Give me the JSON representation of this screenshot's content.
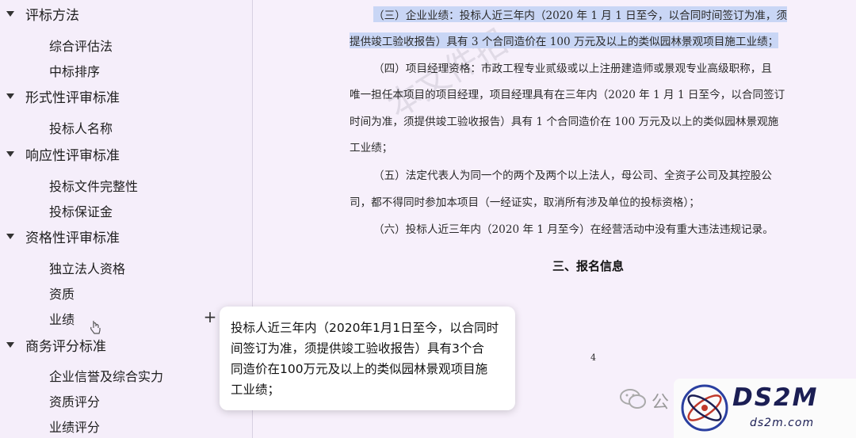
{
  "sidebar": {
    "groups": [
      {
        "label": "评标方法",
        "items": [
          "综合评估法",
          "中标排序"
        ]
      },
      {
        "label": "形式性评审标准",
        "items": [
          "投标人名称"
        ]
      },
      {
        "label": "响应性评审标准",
        "items": [
          "投标文件完整性",
          "投标保证金"
        ]
      },
      {
        "label": "资格性评审标准",
        "items": [
          "独立法人资格",
          "资质",
          "业绩"
        ]
      },
      {
        "label": "商务评分标准",
        "items": [
          "企业信誉及综合实力",
          "资质评分",
          "业绩评分"
        ]
      }
    ],
    "add_icon": "plus-icon"
  },
  "document": {
    "lines": [
      "（三）企业业绩：投标人近三年内（2020 年 1 月 1 日至今，以合同时间签订为准，须",
      "提供竣工验收报告）具有 3 个合同造价在 100 万元及以上的类似园林景观项目施工业绩；",
      "（四）项目经理资格：市政工程专业贰级或以上注册建造师或景观专业高级职称，且",
      "唯一担任本项目的项目经理，项目经理具有在三年内（2020 年 1 月 1 日至今，以合同签订",
      "时间为准，须提供竣工验收报告）具有 1 个合同造价在 100 万元及以上的类似园林景观施",
      "工业绩；",
      "（五）法定代表人为同一个的两个及两个以上法人，母公司、全资子公司及其控股公",
      "司，都不得同时参加本项目（一经证实，取消所有涉及单位的投标资格）；",
      "（六）投标人近三年内（2020 年 1 月至今）在经营活动中没有重大违法违规记录。"
    ],
    "section_title": "三、报名信息",
    "page_number": "4"
  },
  "tooltip": {
    "lines": [
      "投标人近三年内（2020年1月1日至今，以合同时",
      "间签订为准，须提供竣工验收报告）具有3个合",
      "同造价在100万元及以上的类似园林景观项目施",
      "工业绩；"
    ]
  },
  "logo": {
    "main": "DS2M",
    "sub": "ds2m.com"
  },
  "wechat_tag": "公"
}
